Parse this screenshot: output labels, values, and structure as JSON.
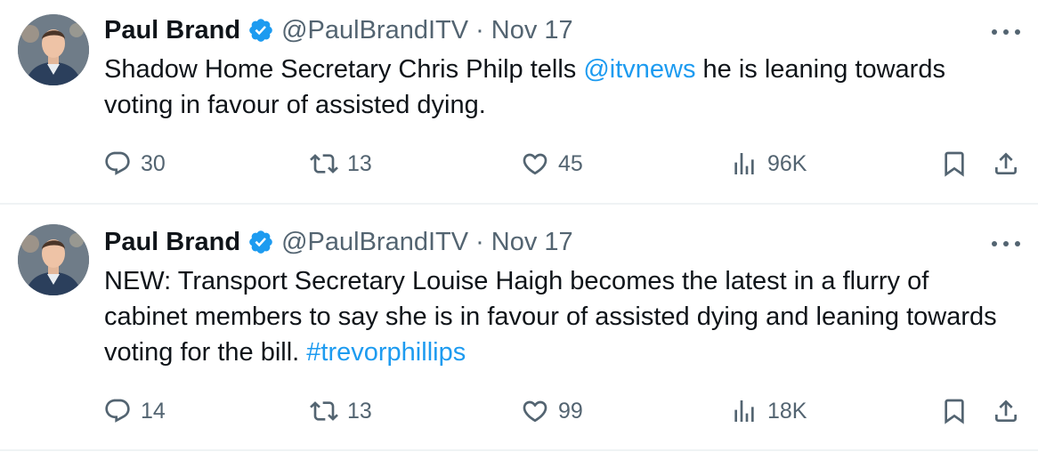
{
  "colors": {
    "text": "#0f1419",
    "secondary": "#536471",
    "link": "#1d9bf0",
    "verified": "#1d9bf0",
    "divider": "#eff3f4"
  },
  "icons": {
    "reply": "speech-bubble-icon",
    "retweet": "retweet-arrows-icon",
    "like": "heart-icon",
    "views": "bar-chart-icon",
    "bookmark": "bookmark-icon",
    "share": "share-upload-icon",
    "more": "more-horizontal-icon",
    "verified": "verified-badge-icon"
  },
  "tweets": [
    {
      "author": {
        "name": "Paul Brand",
        "handle": "@PaulBrandITV"
      },
      "separator": "·",
      "date": "Nov 17",
      "text_before": "Shadow Home Secretary Chris Philp tells ",
      "text_link": "@itvnews",
      "text_after": " he is leaning towards voting in favour of assisted dying.",
      "stats": {
        "replies": "30",
        "retweets": "13",
        "likes": "45",
        "views": "96K"
      }
    },
    {
      "author": {
        "name": "Paul Brand",
        "handle": "@PaulBrandITV"
      },
      "separator": "·",
      "date": "Nov 17",
      "text_before": "NEW: Transport Secretary Louise Haigh becomes the latest in a flurry of cabinet members to say she is in favour of assisted dying and leaning towards voting for the bill. ",
      "text_link": "#trevorphillips",
      "text_after": "",
      "stats": {
        "replies": "14",
        "retweets": "13",
        "likes": "99",
        "views": "18K"
      }
    }
  ]
}
